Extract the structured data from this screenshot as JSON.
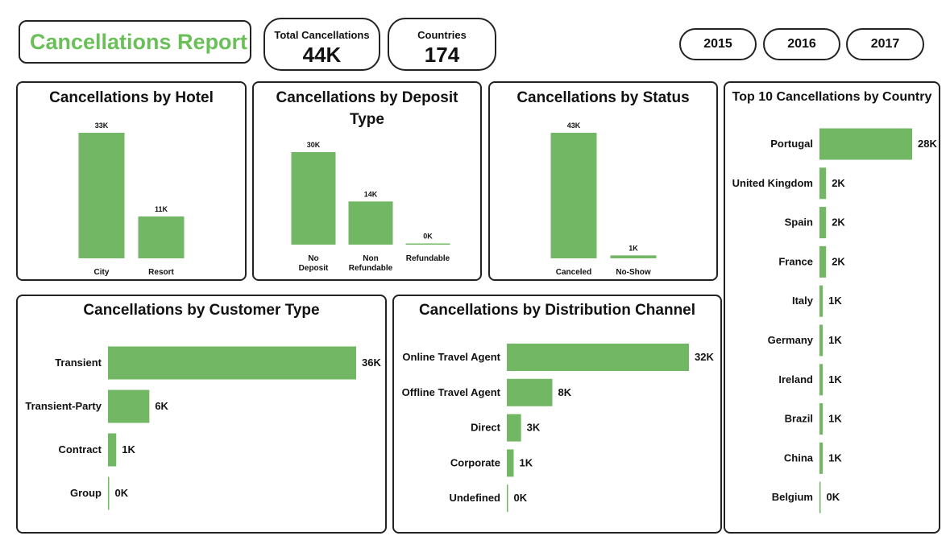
{
  "header": {
    "report_title": "Cancellations Report",
    "total_label": "Total Cancellations",
    "total_value": "44K",
    "countries_label": "Countries",
    "countries_value": "174",
    "years": [
      "2015",
      "2016",
      "2017"
    ]
  },
  "colors": {
    "bar": "#72b763",
    "title_green": "#6bbf59",
    "border": "#222222"
  },
  "chart_data": [
    {
      "id": "hotel",
      "type": "bar",
      "title": "Cancellations by Hotel",
      "categories": [
        "City",
        "Resort"
      ],
      "values": [
        33,
        11
      ],
      "labels": [
        "33K",
        "11K"
      ]
    },
    {
      "id": "deposit",
      "type": "bar",
      "title": "Cancellations by Deposit Type",
      "categories": [
        "No Deposit",
        "Non Refundable",
        "Refundable"
      ],
      "values": [
        30,
        14,
        0.1
      ],
      "labels": [
        "30K",
        "14K",
        "0K"
      ]
    },
    {
      "id": "status",
      "type": "bar",
      "title": "Cancellations by Status",
      "categories": [
        "Canceled",
        "No-Show"
      ],
      "values": [
        43,
        1
      ],
      "labels": [
        "43K",
        "1K"
      ]
    },
    {
      "id": "country",
      "type": "bar",
      "orientation": "horizontal",
      "title": "Top 10 Cancellations by Country",
      "categories": [
        "Portugal",
        "United Kingdom",
        "Spain",
        "France",
        "Italy",
        "Germany",
        "Ireland",
        "Brazil",
        "China",
        "Belgium"
      ],
      "values": [
        28,
        2,
        2,
        2,
        1,
        1,
        1,
        1,
        1,
        0.3
      ],
      "labels": [
        "28K",
        "2K",
        "2K",
        "2K",
        "1K",
        "1K",
        "1K",
        "1K",
        "1K",
        "0K"
      ]
    },
    {
      "id": "customer",
      "type": "bar",
      "orientation": "horizontal",
      "title": "Cancellations by Customer Type",
      "categories": [
        "Transient",
        "Transient-Party",
        "Contract",
        "Group"
      ],
      "values": [
        36,
        6,
        1.2,
        0.1
      ],
      "labels": [
        "36K",
        "6K",
        "1K",
        "0K"
      ]
    },
    {
      "id": "channel",
      "type": "bar",
      "orientation": "horizontal",
      "title": "Cancellations by Distribution Channel",
      "categories": [
        "Online Travel Agent",
        "Offline Travel Agent",
        "Direct",
        "Corporate",
        "Undefined"
      ],
      "values": [
        32,
        8,
        2.5,
        1.2,
        0.1
      ],
      "labels": [
        "32K",
        "8K",
        "3K",
        "1K",
        "0K"
      ]
    }
  ]
}
